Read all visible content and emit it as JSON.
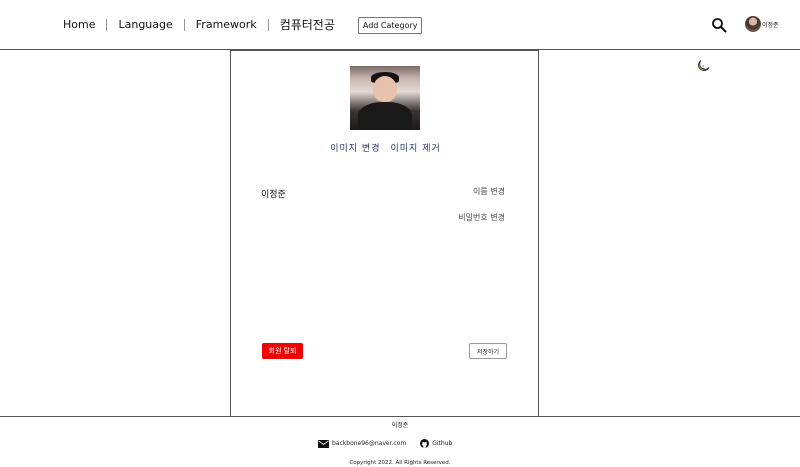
{
  "nav": {
    "items": [
      "Home",
      "Language",
      "Framework",
      "컴퓨터전공"
    ],
    "add_category": "Add Category"
  },
  "header": {
    "user_name": "이정준",
    "icons": [
      "search-icon",
      "avatar"
    ]
  },
  "theme_toggle_icon": "moon-icon",
  "profile": {
    "change_image": "이미지 변경",
    "remove_image": "이미지 제거",
    "name": "이정준",
    "change_name": "이름 변경",
    "change_password": "비밀번호 변경",
    "withdraw": "회원 탈퇴",
    "save": "저장하기"
  },
  "footer": {
    "name": "이정준",
    "email": "backbone96@naver.com",
    "github": "Github",
    "copyright": "Copyright 2022. All Rights Reserved."
  },
  "colors": {
    "withdraw_button": "#f00000",
    "link_text": "#2b3a6a",
    "moon": "#f5c518"
  }
}
